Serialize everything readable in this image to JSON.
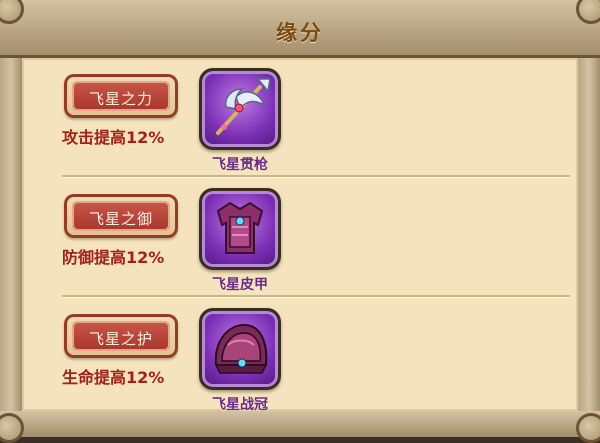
{
  "title": "缘分",
  "rows": [
    {
      "tag": "飞星之力",
      "bonus": "攻击提高12%",
      "item": "飞星贯枪",
      "icon": "spear-icon"
    },
    {
      "tag": "飞星之御",
      "bonus": "防御提高12%",
      "item": "飞星皮甲",
      "icon": "armor-icon"
    },
    {
      "tag": "飞星之护",
      "bonus": "生命提高12%",
      "item": "飞星战冠",
      "icon": "helmet-icon"
    }
  ],
  "colors": {
    "panel": "#f5e3bd",
    "tag_red": "#b8453a",
    "bonus_text": "#a5201a",
    "item_purple": "#7a2fb4",
    "title_text": "#7a4a12"
  }
}
